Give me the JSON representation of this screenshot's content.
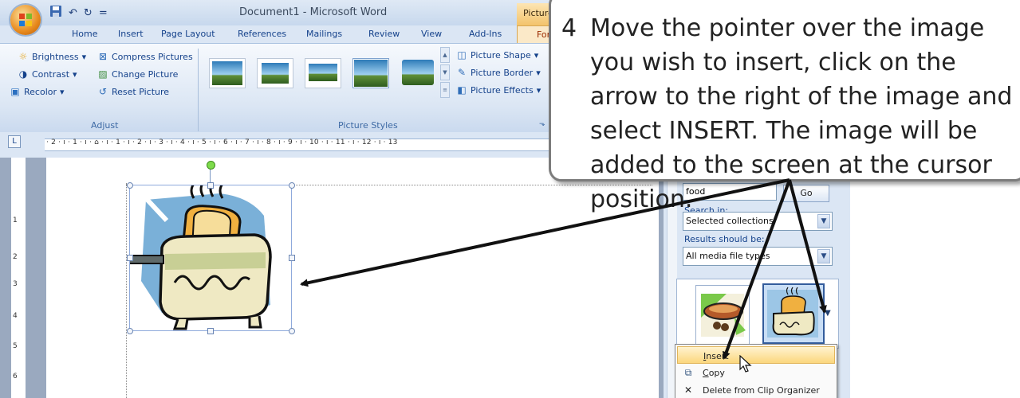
{
  "window": {
    "title": "Document1 - Microsoft Word",
    "context_tab_header": "Picture"
  },
  "quick_access": {
    "save_icon": "save-icon",
    "undo_label": "↶",
    "redo_label": "↻",
    "more_label": "="
  },
  "tabs": [
    {
      "label": "Home"
    },
    {
      "label": "Insert"
    },
    {
      "label": "Page Layout"
    },
    {
      "label": "References"
    },
    {
      "label": "Mailings"
    },
    {
      "label": "Review"
    },
    {
      "label": "View"
    },
    {
      "label": "Add-Ins"
    },
    {
      "label": "For"
    }
  ],
  "ribbon": {
    "adjust": {
      "brightness": "Brightness",
      "contrast": "Contrast",
      "recolor": "Recolor",
      "compress": "Compress Pictures",
      "change": "Change Picture",
      "reset": "Reset Picture",
      "group_label": "Adjust",
      "dropdown_mark": "▾"
    },
    "picture_styles": {
      "shape": "Picture Shape",
      "border": "Picture Border",
      "effects": "Picture Effects",
      "group_label": "Picture Styles"
    }
  },
  "ruler": {
    "corner": "L",
    "marks": "· 2 · ı · 1 · ı · ⌂ · ı · 1 · ı · 2 · ı · 3 · ı · 4 · ı · 5 · ı · 6 · ı · 7 · ı · 8 · ı · 9 · ı · 10 · ı · 11 · ı · 12 · ı · 13",
    "vertical": [
      "1",
      "2",
      "3",
      "4",
      "5",
      "6"
    ]
  },
  "clip_art_pane": {
    "search_value": "food",
    "go_label": "Go",
    "search_in_label": "Search in:",
    "search_in_value": "Selected collections",
    "results_label": "Results should be:",
    "results_value": "All media file types"
  },
  "context_menu": {
    "items": [
      {
        "label": "Insert",
        "accel": "I",
        "rest": "nsert",
        "icon": "insert-icon"
      },
      {
        "label": "Copy",
        "accel": "C",
        "rest": "opy",
        "icon": "copy-icon"
      },
      {
        "label": "Delete from Clip Organizer",
        "accel": "",
        "rest": "Delete from Clip Organizer",
        "icon": "delete-icon"
      }
    ]
  },
  "callout": {
    "number": "4",
    "text": "Move the pointer over the image you wish to insert, click on the arrow to the right of the image and select INSERT. The image will be added to the screen at the cursor position."
  }
}
